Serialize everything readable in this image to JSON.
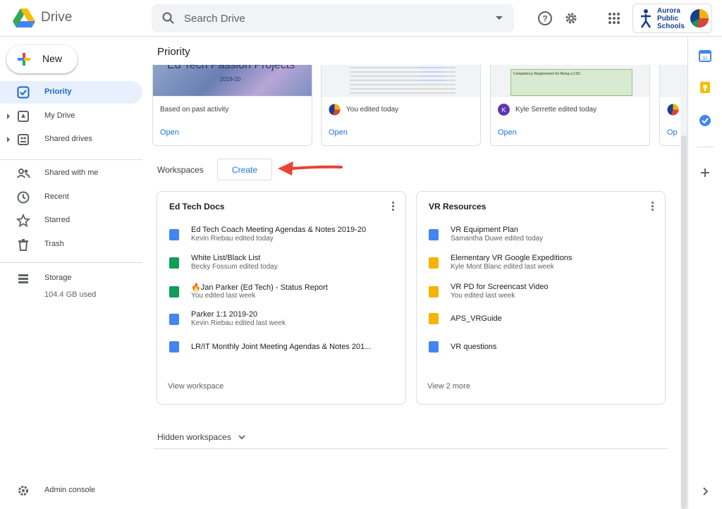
{
  "app": {
    "name": "Drive"
  },
  "search": {
    "placeholder": "Search Drive"
  },
  "account": {
    "school_name": "Aurora\nPublic\nSchools"
  },
  "sidebar": {
    "new_label": "New",
    "items": [
      {
        "label": "Priority",
        "icon": "priority-icon"
      },
      {
        "label": "My Drive",
        "icon": "my-drive-icon"
      },
      {
        "label": "Shared drives",
        "icon": "shared-drives-icon"
      },
      {
        "label": "Shared with me",
        "icon": "people-icon"
      },
      {
        "label": "Recent",
        "icon": "clock-icon"
      },
      {
        "label": "Starred",
        "icon": "star-icon"
      },
      {
        "label": "Trash",
        "icon": "trash-icon"
      },
      {
        "label": "Storage",
        "icon": "storage-icon"
      }
    ],
    "storage_used": "104.4 GB used",
    "admin_console": "Admin console"
  },
  "main": {
    "title": "Priority",
    "recent_cards": [
      {
        "thumb_text": "Ed Tech Passion Projects",
        "thumb_sub": "2019-20",
        "activity": "Based on past activity",
        "open_label": "Open"
      },
      {
        "activity": "You edited today",
        "open_label": "Open"
      },
      {
        "activity": "Kyle Serrette edited today",
        "avatar_letter": "K",
        "open_label": "Open",
        "thumb_text": "Competency Requirement for Being a CSC"
      },
      {
        "open_label": "Op"
      }
    ],
    "workspaces_label": "Workspaces",
    "create_label": "Create",
    "workspaces": [
      {
        "title": "Ed Tech Docs",
        "files": [
          {
            "name": "Ed Tech Coach Meeting Agendas & Notes 2019-20",
            "sub": "Kevin Riebau edited today",
            "type": "doc"
          },
          {
            "name": "White List/Black List",
            "sub": "Becky Fossum edited today",
            "type": "sheet"
          },
          {
            "name": "🔥Jan Parker (Ed Tech) - Status Report",
            "sub": "You edited last week",
            "type": "sheet"
          },
          {
            "name": "Parker 1:1 2019-20",
            "sub": "Kevin Riebau edited last week",
            "type": "doc"
          },
          {
            "name": "LR/IT Monthly Joint Meeting Agendas & Notes 201...",
            "sub": "",
            "type": "doc"
          }
        ],
        "footer": "View workspace"
      },
      {
        "title": "VR Resources",
        "files": [
          {
            "name": "VR Equipment Plan",
            "sub": "Samantha Duwe edited today",
            "type": "doc"
          },
          {
            "name": "Elementary VR Google Expeditions",
            "sub": "Kyle Mont Blanc edited last week",
            "type": "slides"
          },
          {
            "name": "VR PD for Screencast Video",
            "sub": "You edited last week",
            "type": "slides"
          },
          {
            "name": "APS_VRGuide",
            "sub": "",
            "type": "slides"
          },
          {
            "name": "VR questions",
            "sub": "",
            "type": "doc"
          }
        ],
        "footer": "View 2 more"
      }
    ],
    "hidden_workspaces": "Hidden workspaces"
  },
  "colors": {
    "doc": "#4285f4",
    "sheet": "#0f9d58",
    "slides": "#f4b400",
    "accent": "#1a73e8",
    "active_bg": "#e8f0fe",
    "arrow": "#ea4335"
  }
}
